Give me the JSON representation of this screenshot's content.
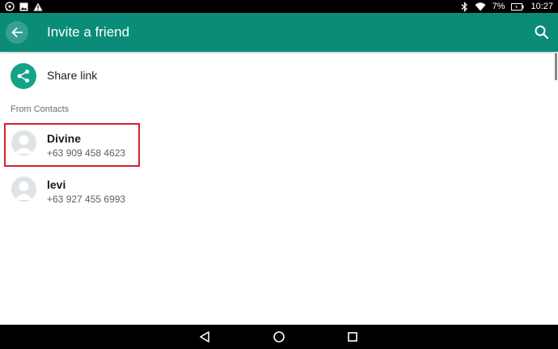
{
  "status_bar": {
    "battery_percent": "7%",
    "time": "10:27",
    "left_icons": [
      "whatsapp-icon",
      "image-icon",
      "warning-icon"
    ],
    "right_icons": [
      "bluetooth-icon",
      "wifi-icon",
      "battery-icon"
    ]
  },
  "toolbar": {
    "title": "Invite a friend",
    "back_icon": "arrow-left-icon",
    "search_icon": "search-icon",
    "color": "#0a8c79"
  },
  "share": {
    "label": "Share link",
    "icon": "share-icon",
    "color": "#14a388"
  },
  "contacts_section": {
    "header": "From Contacts",
    "items": [
      {
        "name": "Divine",
        "phone": "+63 909 458 4623",
        "highlighted": true
      },
      {
        "name": "levi",
        "phone": "+63 927 455 6993",
        "highlighted": false
      }
    ]
  },
  "nav_bar": {
    "buttons": [
      "back-triangle-icon",
      "home-circle-icon",
      "recents-square-icon"
    ]
  }
}
